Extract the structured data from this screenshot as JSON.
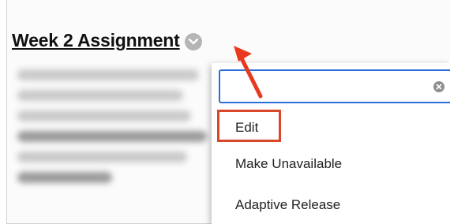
{
  "item": {
    "title": "Week 2 Assignment"
  },
  "menu": {
    "search_value": "",
    "items": [
      {
        "label": "Edit"
      },
      {
        "label": "Make Unavailable"
      },
      {
        "label": "Adaptive Release"
      }
    ]
  },
  "icons": {
    "options": "chevron-down-icon",
    "clear": "close-icon",
    "callout": "arrow-icon"
  },
  "colors": {
    "highlight": "#d9472b",
    "focus_border": "#2a6edb",
    "option_button": "#b5b5b5"
  }
}
